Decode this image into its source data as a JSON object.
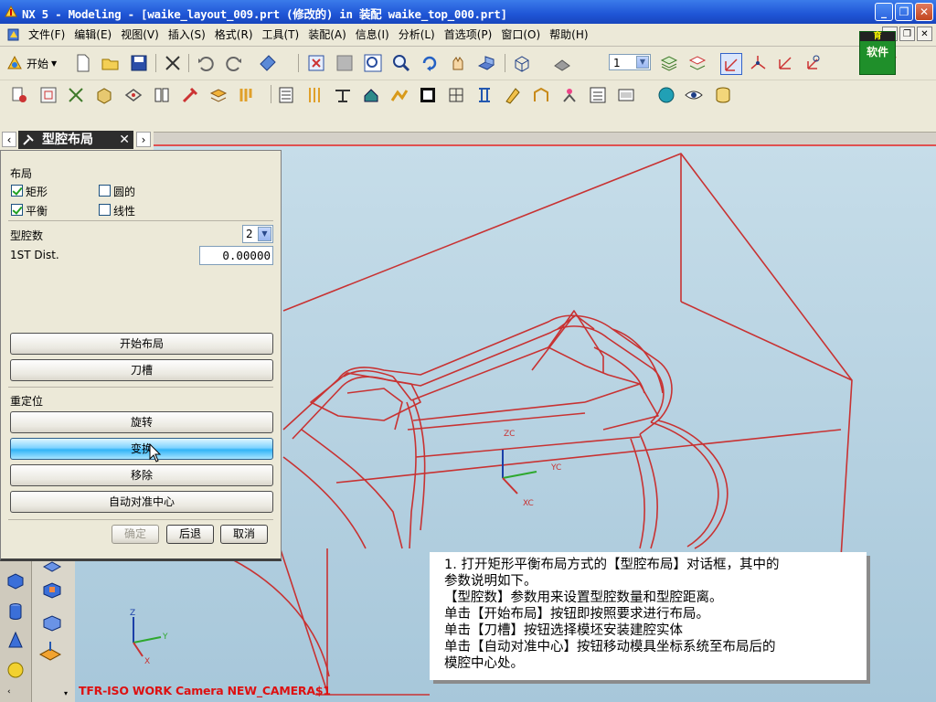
{
  "window": {
    "title": "NX 5 - Modeling - [waike_layout_009.prt (修改的) in 装配 waike_top_000.prt]",
    "controls": [
      "_",
      "❐",
      "✕"
    ]
  },
  "menubar": {
    "items": [
      "文件(F)",
      "编辑(E)",
      "视图(V)",
      "插入(S)",
      "格式(R)",
      "工具(T)",
      "装配(A)",
      "信息(I)",
      "分析(L)",
      "首选项(P)",
      "窗口(O)",
      "帮助(H)"
    ]
  },
  "logo_badge": {
    "line1": "育",
    "line2": "软件"
  },
  "toolbar": {
    "start_label": "开始",
    "layer_value": "1"
  },
  "dialog": {
    "title": "型腔布局",
    "layout_section": "布局",
    "options": {
      "rect": {
        "label": "矩形",
        "checked": true
      },
      "circular": {
        "label": "圆的",
        "checked": false
      },
      "balanced": {
        "label": "平衡",
        "checked": true
      },
      "linear": {
        "label": "线性",
        "checked": false
      }
    },
    "cavity_count_label": "型腔数",
    "cavity_count_value": "2",
    "first_dist_label": "1ST Dist.",
    "first_dist_value": "0.00000",
    "start_layout_button": "开始布局",
    "pocket_button": "刀槽",
    "reposition_section": "重定位",
    "rotate_button": "旋转",
    "transform_button": "变换",
    "remove_button": "移除",
    "auto_center_button": "自动对准中心",
    "ok_button": "确定",
    "back_button": "后退",
    "cancel_button": "取消"
  },
  "viewport": {
    "wcs_labels": {
      "zc": "ZC",
      "yc": "YC",
      "xc": "XC"
    },
    "abs_labels": {
      "z": "Z",
      "y": "Y",
      "x": "X"
    },
    "caption": "TFR-ISO WORK Camera NEW_CAMERA$1"
  },
  "callout": {
    "lines": [
      "1. 打开矩形平衡布局方式的【型腔布局】对话框，其中的",
      "参数说明如下。",
      "【型腔数】参数用来设置型腔数量和型腔距离。",
      "单击【开始布局】按钮即按照要求进行布局。",
      "单击【刀槽】按钮选择模坯安装建腔实体",
      "单击【自动对准中心】按钮移动模具坐标系统至布局后的",
      "模腔中心处。"
    ]
  },
  "colors": {
    "model_wire": "#c83232",
    "titlebar": "#1f55d6",
    "active_button": "#32b4f7"
  }
}
